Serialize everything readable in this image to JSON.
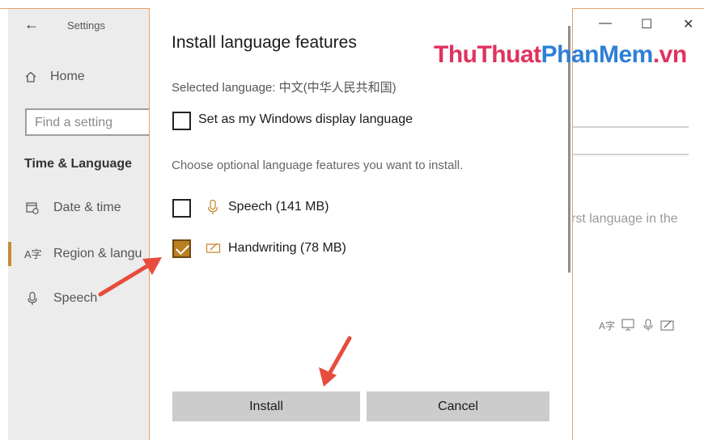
{
  "window": {
    "app_title": "Settings",
    "back_icon": "←",
    "caption_icons": {
      "minimize": "—",
      "maximize": "☐",
      "close": "✕"
    }
  },
  "sidebar": {
    "home_label": "Home",
    "search_placeholder": "Find a setting",
    "section_title": "Time & Language",
    "items": [
      {
        "label": "Date & time",
        "icon": "calendar-clock-icon"
      },
      {
        "label": "Region & langu",
        "icon": "language-icon"
      },
      {
        "label": "Speech",
        "icon": "microphone-icon"
      }
    ]
  },
  "background_content": {
    "partial_text": "rst language in the"
  },
  "watermark": {
    "part1": "ThuThuat",
    "part2": "PhanMem",
    "part3": ".vn"
  },
  "dialog": {
    "title": "Install language features",
    "selected_language": "Selected language: 中文(中华人民共和国)",
    "display_language_option": {
      "label": "Set as my Windows display language",
      "checked": false
    },
    "choose_text": "Choose optional language features you want to install.",
    "features": [
      {
        "label": "Speech (141 MB)",
        "icon": "microphone-icon",
        "checked": false
      },
      {
        "label": "Handwriting (78 MB)",
        "icon": "pen-icon",
        "checked": true
      }
    ],
    "install_label": "Install",
    "cancel_label": "Cancel"
  },
  "colors": {
    "accent": "#c98a35",
    "window_border": "#e8a06a",
    "annotation_arrow": "#e74c3c",
    "button_bg": "#cccccc"
  }
}
